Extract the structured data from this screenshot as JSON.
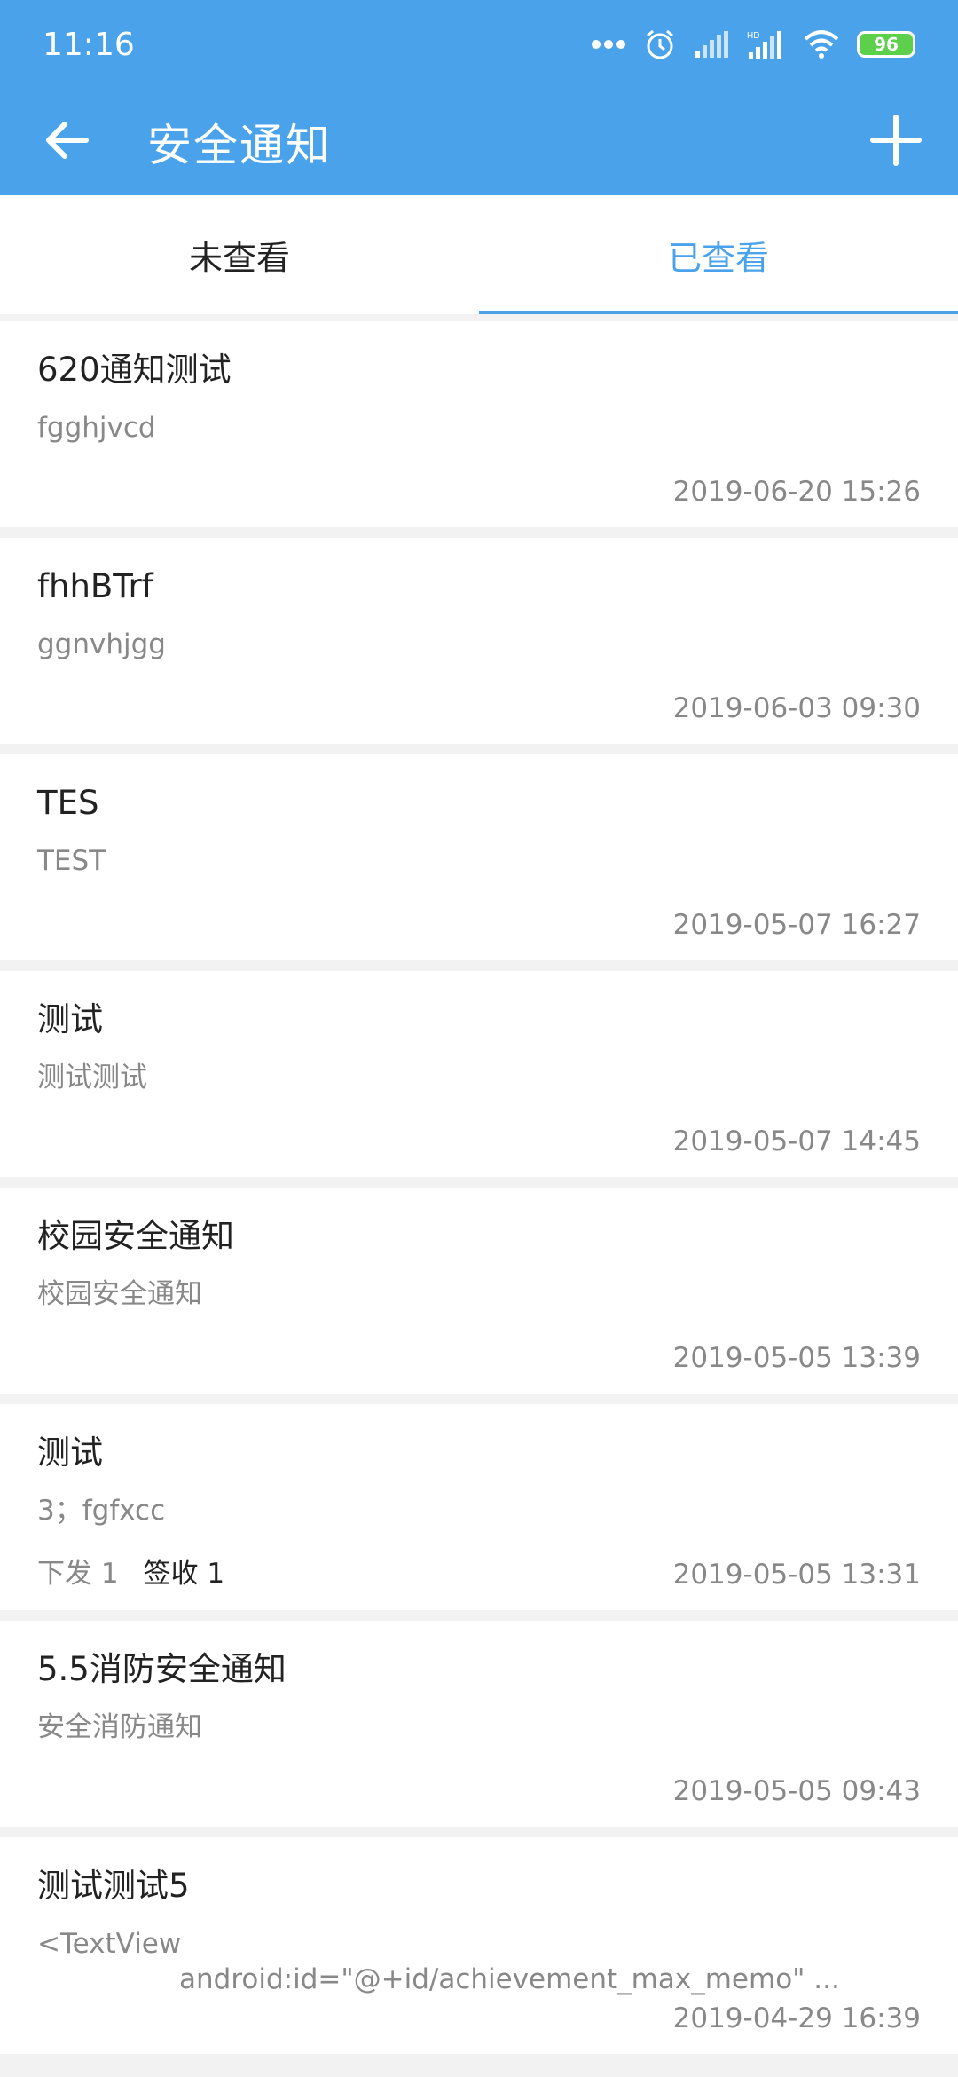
{
  "status_bar": {
    "time": "11:16",
    "battery": "96"
  },
  "toolbar": {
    "title": "安全通知"
  },
  "tabs": [
    {
      "label": "未查看",
      "active": false
    },
    {
      "label": "已查看",
      "active": true
    }
  ],
  "notices": [
    {
      "title": "620通知测试",
      "summary": "fgghjvcd",
      "date": "2019-06-20 15:26"
    },
    {
      "title": "fhhBTrf",
      "summary": "ggnvhjgg",
      "date": "2019-06-03 09:30"
    },
    {
      "title": "TES",
      "summary": "TEST",
      "date": "2019-05-07 16:27"
    },
    {
      "title": "测试",
      "summary": "测试测试",
      "date": "2019-05-07 14:45"
    },
    {
      "title": "校园安全通知",
      "summary": "校园安全通知",
      "date": "2019-05-05 13:39"
    },
    {
      "title": "测试",
      "summary": "3；fgfxcc",
      "issued": "下发 1",
      "signed": "签收 1",
      "date": "2019-05-05 13:31"
    },
    {
      "title": "5.5消防安全通知",
      "summary": "安全消防通知",
      "date": "2019-05-05 09:43"
    },
    {
      "title": "测试测试5",
      "summary": "<TextView",
      "summary_line2": "android:id=\"@+id/achievement_max_memo\" ...",
      "date": "2019-04-29 16:39"
    }
  ],
  "colors": {
    "primary": "#4aa3ea",
    "battery": "#5cd04b"
  }
}
